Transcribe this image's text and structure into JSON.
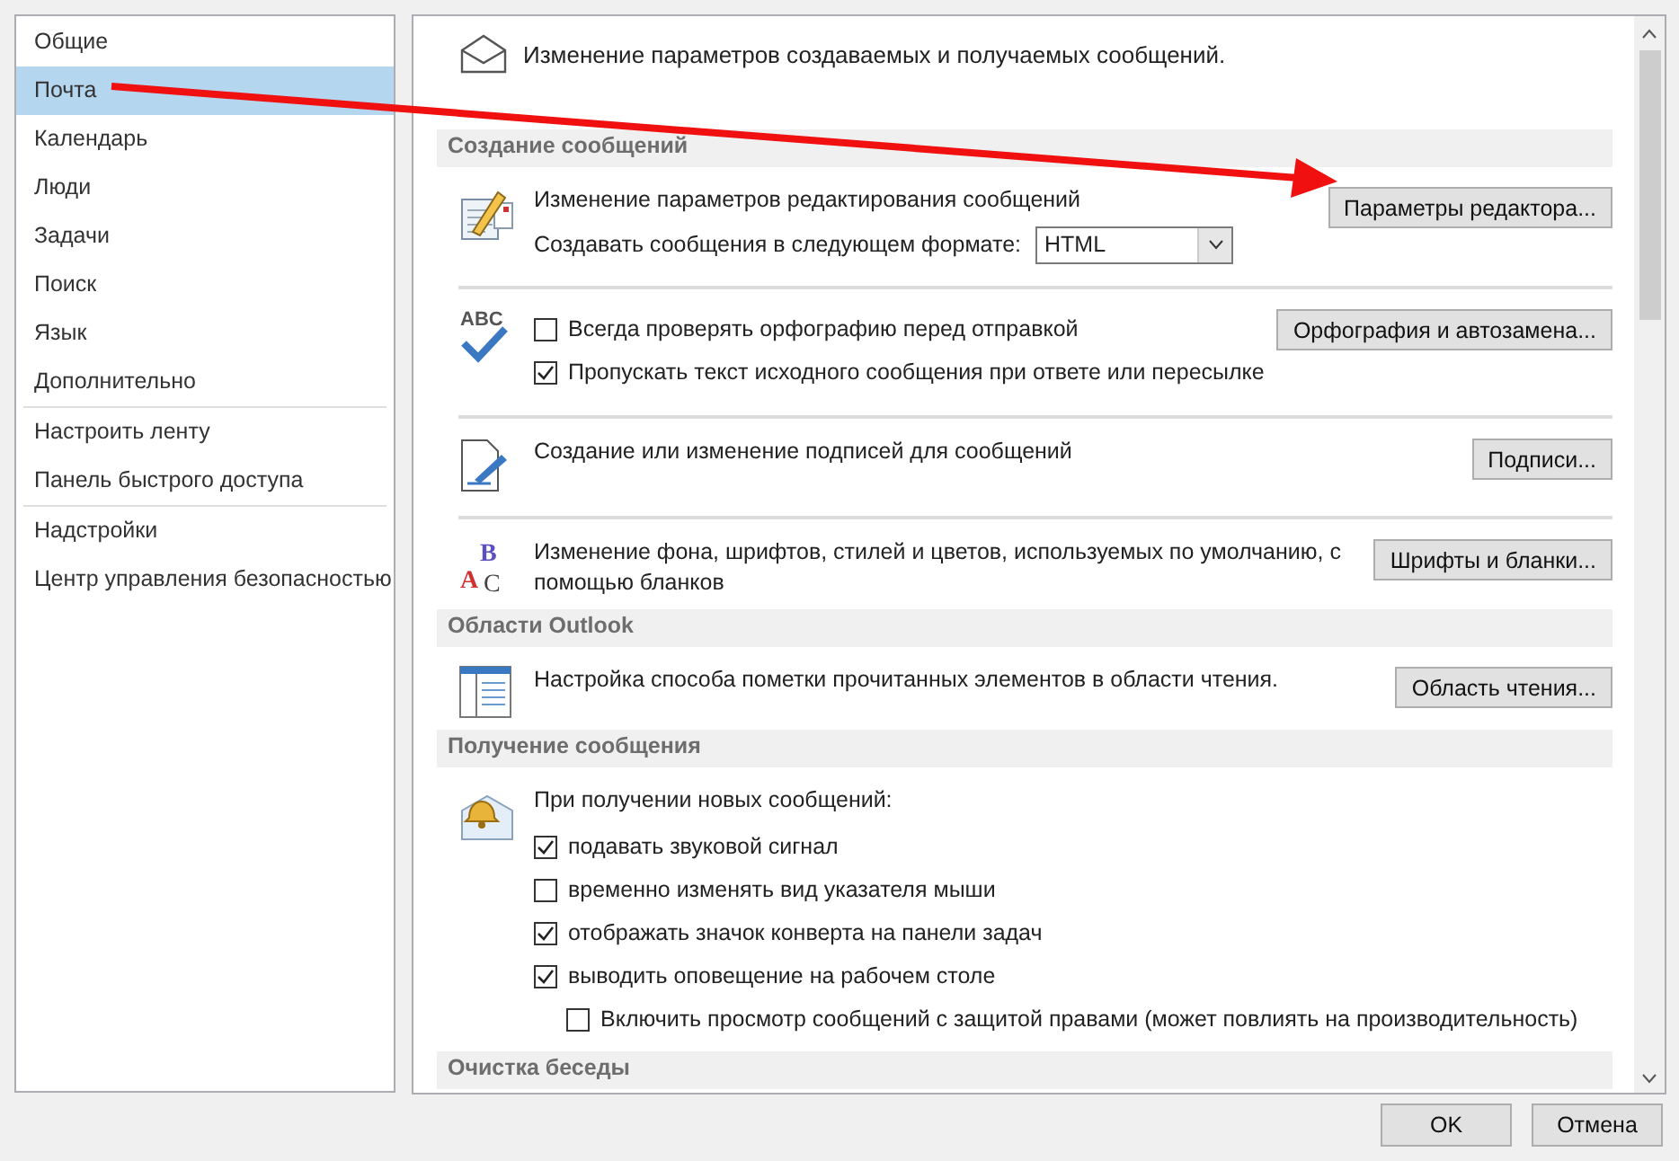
{
  "sidebar": {
    "groups": [
      [
        {
          "label": "Общие",
          "selected": false
        },
        {
          "label": "Почта",
          "selected": true
        },
        {
          "label": "Календарь",
          "selected": false
        },
        {
          "label": "Люди",
          "selected": false
        },
        {
          "label": "Задачи",
          "selected": false
        },
        {
          "label": "Поиск",
          "selected": false
        },
        {
          "label": "Язык",
          "selected": false
        },
        {
          "label": "Дополнительно",
          "selected": false
        }
      ],
      [
        {
          "label": "Настроить ленту",
          "selected": false
        },
        {
          "label": "Панель быстрого доступа",
          "selected": false
        }
      ],
      [
        {
          "label": "Надстройки",
          "selected": false
        },
        {
          "label": "Центр управления безопасностью",
          "selected": false
        }
      ]
    ]
  },
  "intro": "Изменение параметров создаваемых и получаемых сообщений.",
  "sections": [
    {
      "title": "Создание сообщений",
      "blocks": [
        {
          "kind": "editor",
          "button": "Параметры редактора...",
          "lines": [
            {
              "kind": "text",
              "text": "Изменение параметров редактирования сообщений"
            },
            {
              "kind": "select",
              "label": "Создавать сообщения в следующем формате:",
              "value": "HTML"
            }
          ]
        },
        {
          "kind": "spelling",
          "icon_text": "ABC",
          "button": "Орфография и автозамена...",
          "lines": [
            {
              "kind": "checkbox",
              "label": "Всегда проверять орфографию перед отправкой",
              "checked": false
            },
            {
              "kind": "checkbox",
              "label": "Пропускать текст исходного сообщения при ответе или пересылке",
              "checked": true
            }
          ]
        },
        {
          "kind": "signature",
          "button": "Подписи...",
          "lines": [
            {
              "kind": "text",
              "text": "Создание или изменение подписей для сообщений"
            }
          ]
        },
        {
          "kind": "fonts",
          "icon_letters": [
            "B",
            "A",
            "C"
          ],
          "button": "Шрифты и бланки...",
          "lines": [
            {
              "kind": "text",
              "text": "Изменение фона, шрифтов, стилей и цветов, используемых по умолчанию, с помощью бланков"
            }
          ]
        }
      ]
    },
    {
      "title": "Области Outlook",
      "blocks": [
        {
          "kind": "reading",
          "button": "Область чтения...",
          "lines": [
            {
              "kind": "text",
              "text": "Настройка способа пометки прочитанных элементов в области чтения."
            }
          ]
        }
      ]
    },
    {
      "title": "Получение сообщения",
      "blocks": [
        {
          "kind": "arrival",
          "lines": [
            {
              "kind": "text",
              "text": "При получении новых сообщений:"
            },
            {
              "kind": "checkbox",
              "label": "подавать звуковой сигнал",
              "checked": true
            },
            {
              "kind": "checkbox",
              "label": "временно изменять вид указателя мыши",
              "checked": false
            },
            {
              "kind": "checkbox",
              "label": "отображать значок конверта на панели задач",
              "checked": true
            },
            {
              "kind": "checkbox",
              "label": "выводить оповещение на рабочем столе",
              "checked": true,
              "children": [
                {
                  "kind": "checkbox",
                  "label": "Включить просмотр сообщений с защитой правами (может повлиять на производительность)",
                  "checked": false
                }
              ]
            }
          ]
        }
      ]
    },
    {
      "title": "Очистка беседы"
    }
  ],
  "buttons": [
    "OK",
    "Отмена"
  ]
}
